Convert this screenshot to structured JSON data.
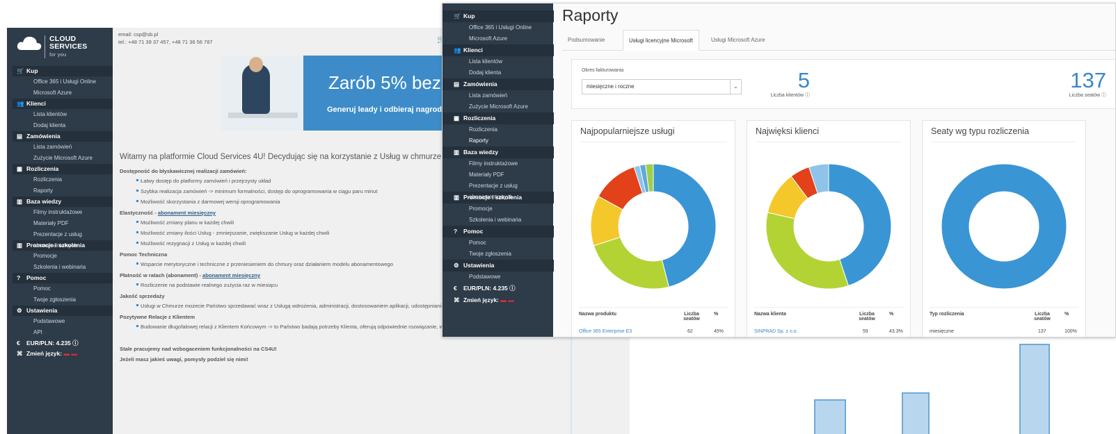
{
  "back": {
    "logo": {
      "brand": "CLOUD SERVICES",
      "tag": "for you"
    },
    "header": {
      "email": "email: csp@sb.pl",
      "phone": "tel.: +48 71 39 37 457, +48 71 36 56 787"
    },
    "menu": [
      {
        "icon": "cart-icon",
        "glyph": "🛒",
        "label": "Kup",
        "items": [
          "Office 365 i Usługi Online",
          "Microsoft Azure"
        ]
      },
      {
        "icon": "users-icon",
        "glyph": "👥",
        "label": "Klienci",
        "items": [
          "Lista klientów",
          "Dodaj klienta"
        ]
      },
      {
        "icon": "orders-icon",
        "glyph": "▤",
        "label": "Zamówienia",
        "items": [
          "Lista zamówień",
          "Zużycie Microsoft Azure"
        ]
      },
      {
        "icon": "calculator-icon",
        "glyph": "▦",
        "label": "Rozliczenia",
        "items": [
          "Rozliczenia",
          "Raporty"
        ]
      },
      {
        "icon": "book-icon",
        "glyph": "▥",
        "label": "Baza wiedzy",
        "items": [
          "Filmy instruktażowe",
          "Materiały PDF",
          "Prezentacje z usług abonamentowych"
        ]
      },
      {
        "icon": "book-icon",
        "glyph": "▥",
        "label": "Promocje i szkolenia",
        "items": [
          "Promocje",
          "Szkolenia i webinaria"
        ]
      },
      {
        "icon": "help-icon",
        "glyph": "?",
        "label": "Pomoc",
        "items": [
          "Pomoc",
          "Twoje zgłoszenia"
        ]
      },
      {
        "icon": "gear-icon",
        "glyph": "⚙",
        "label": "Ustawienia",
        "items": [
          "Podstawowe",
          "API"
        ]
      }
    ],
    "rate": "EUR/PLN: 4.235",
    "lang": "Zmień język:",
    "banner": {
      "title": "Zarób 5% bez",
      "sub": "Generuj leady i odbieraj nagrody!"
    },
    "welcome": "Witamy na platformie Cloud Services 4U!  Decydując się na korzystanie z Usług w chmurze zyskuje",
    "sections": [
      {
        "title": "Dostępność do błyskawicznej realizacji zamówień:",
        "link": "",
        "bullets": [
          "Łatwy dostęp do platformy zamówień i przejrzysty układ",
          "Szybka realizacja zamówień -> minimum formalności, dostęp do oprogramowania w ciągu paru minut",
          "Możliwość skorzystania z darmowej wersji oprogramowania"
        ]
      },
      {
        "title": "Elastyczność -",
        "link": "abonament miesięczny",
        "bullets": [
          "Możliwość zmiany planu w każdej chwili",
          "Możliwość zmiany ilości Usług - zmniejszanie, zwiększanie Usług w każdej chwili",
          "Możliwość rezygnacji z Usług w każdej chwili"
        ]
      },
      {
        "title": "Pomoc Techniczna",
        "link": "",
        "bullets": [
          "Wsparcie merytoryczne i techniczne z przeniesieniem do chmury oraz działaniem modelu abonamentowego"
        ]
      },
      {
        "title": "Płatność w ratach (abonament) -",
        "link": "abonament miesięczny",
        "bullets": [
          "Rozliczenie na podstawie realnego zużycia raz w miesiącu"
        ]
      },
      {
        "title": "Jakość sprzedaży",
        "link": "",
        "bullets": [
          "Usługi w Chmurze możecie Państwo sprzedawać wraz z Usługą wdrożenia, administracji, dostosowaniem aplikacji, udostępnianiem w danym środowisku, migracją danych"
        ]
      },
      {
        "title": "Pozytywne Relacje z Klientem",
        "link": "",
        "bullets": [
          "Budowanie długofalowej relacji z Klientem Końcowym -> to Państwo badają potrzeby Klienta, oferują odpowiednie rozwiązanie, wdrażają jak i zarządzają"
        ]
      }
    ],
    "tail1": "Stale pracujemy nad wzbogaceniem funkcjonalności na CS4U!",
    "tail2": "Jeżeli masz jakieś uwagi, pomysły podziel się nimi!"
  },
  "front": {
    "menu": [
      {
        "icon": "cart-icon",
        "glyph": "🛒",
        "label": "Kup",
        "items": [
          "Office 365 i Usługi Online",
          "Microsoft Azure"
        ]
      },
      {
        "icon": "users-icon",
        "glyph": "👥",
        "label": "Klienci",
        "items": [
          "Lista klientów",
          "Dodaj klienta"
        ]
      },
      {
        "icon": "orders-icon",
        "glyph": "▤",
        "label": "Zamówienia",
        "items": [
          "Lista zamówień",
          "Zużycie Microsoft Azure"
        ]
      },
      {
        "icon": "calculator-icon",
        "glyph": "▦",
        "label": "Rozliczenia",
        "items": [
          "Rozliczenia",
          "Raporty"
        ]
      },
      {
        "icon": "book-icon",
        "glyph": "▥",
        "label": "Baza wiedzy",
        "items": [
          "Filmy instruktażowe",
          "Materiały PDF",
          "Prezentacje z usług abonamentowych"
        ]
      },
      {
        "icon": "book-icon",
        "glyph": "▥",
        "label": "Promocje i szkolenia",
        "items": [
          "Promocje",
          "Szkolenia i webinaria"
        ]
      },
      {
        "icon": "help-icon",
        "glyph": "?",
        "label": "Pomoc",
        "items": [
          "Pomoc",
          "Twoje zgłoszenia"
        ]
      },
      {
        "icon": "gear-icon",
        "glyph": "⚙",
        "label": "Ustawienia",
        "items": [
          "Podstawowe"
        ]
      }
    ],
    "active_item": "Raporty",
    "rate": "EUR/PLN: 4.235",
    "lang": "Zmień język:",
    "title": "Raporty",
    "tabs": [
      "Podsumowanie",
      "Usługi licencyjne Microsoft",
      "Usługi Microsoft Azure"
    ],
    "active_tab": 1,
    "filter": {
      "label": "Okres fakturowania",
      "value": "miesięczne i roczne"
    },
    "stats": [
      {
        "value": "5",
        "caption": "Liczba klientów"
      },
      {
        "value": "137",
        "caption": "Liczba seatów"
      }
    ],
    "panels": [
      {
        "title": "Najpopularniejsze usługi",
        "cols": [
          "Nazwa produktu",
          "Liczba seatów",
          "%"
        ],
        "row": [
          "Office 365 Enterprise E3",
          "62",
          "45%"
        ]
      },
      {
        "title": "Najwięksi klienci",
        "cols": [
          "Nazwa klienta",
          "Liczba seatów",
          "%"
        ],
        "row": [
          "SINPRAD Sp. z o.o.",
          "59",
          "43.3%"
        ]
      },
      {
        "title": "Seaty wg typu rozliczenia",
        "cols": [
          "Typ rozliczenia",
          "Liczba seatów",
          "%"
        ],
        "row": [
          "miesięczne",
          "137",
          "100%"
        ]
      }
    ]
  },
  "chart_data": [
    {
      "type": "pie",
      "title": "Najpopularniejsze usługi",
      "values": [
        46,
        24,
        13,
        12,
        1.5,
        1.5,
        2
      ],
      "colors": [
        "#3a95d5",
        "#b3d334",
        "#f4c82b",
        "#e2411a",
        "#8fc3ea",
        "#5fa8de",
        "#9fcf4a"
      ]
    },
    {
      "type": "pie",
      "title": "Najwięksi klienci",
      "values": [
        44,
        33,
        11,
        5,
        5
      ],
      "colors": [
        "#3a95d5",
        "#b3d334",
        "#f4c82b",
        "#e2411a",
        "#8fc3ea"
      ]
    },
    {
      "type": "pie",
      "title": "Seaty wg typu rozliczenia",
      "values": [
        100
      ],
      "colors": [
        "#3a95d5"
      ]
    }
  ]
}
